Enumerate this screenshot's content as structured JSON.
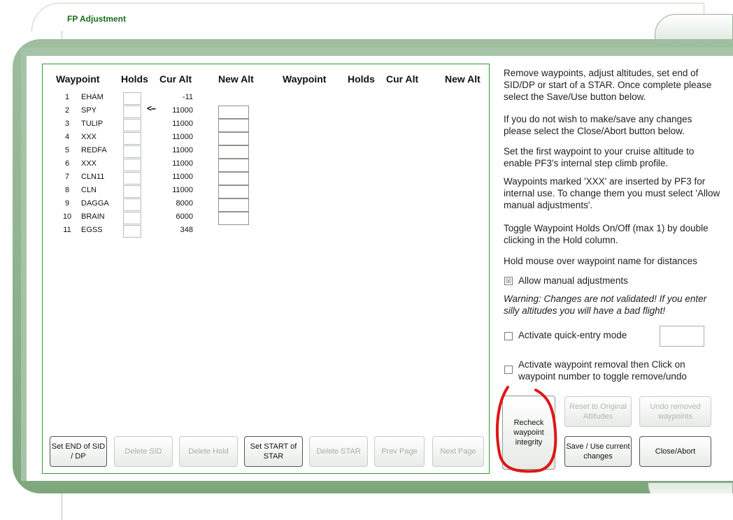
{
  "window": {
    "title": "FP Adjustment"
  },
  "table": {
    "headers": [
      "Waypoint",
      "Holds",
      "Cur Alt",
      "New Alt",
      "Waypoint",
      "Holds",
      "Cur Alt",
      "New Alt"
    ],
    "rows": [
      {
        "num": "1",
        "name": "EHAM",
        "cur": "-11"
      },
      {
        "num": "2",
        "name": "SPY",
        "cur": "11000"
      },
      {
        "num": "3",
        "name": "TULIP",
        "cur": "11000"
      },
      {
        "num": "4",
        "name": "XXX",
        "cur": "11000"
      },
      {
        "num": "5",
        "name": "REDFA",
        "cur": "11000"
      },
      {
        "num": "6",
        "name": "XXX",
        "cur": "11000"
      },
      {
        "num": "7",
        "name": "CLN11",
        "cur": "11000"
      },
      {
        "num": "8",
        "name": "CLN",
        "cur": "11000"
      },
      {
        "num": "9",
        "name": "DAGGA",
        "cur": "8000"
      },
      {
        "num": "10",
        "name": "BRAIN",
        "cur": "6000"
      },
      {
        "num": "11",
        "name": "EGSS",
        "cur": "348"
      }
    ],
    "current_arrow": "<--"
  },
  "buttons": {
    "set_end_sid": "Set END of SID / DP",
    "delete_sid": "Delete SID",
    "delete_hold": "Delete Hold",
    "set_start_star": "Set START of STAR",
    "delete_star": "Delete STAR",
    "prev_page": "Prev Page",
    "next_page": "Next Page"
  },
  "info": {
    "p1": "Remove waypoints, adjust altitudes, set end of SID/DP or start of a STAR. Once complete please select the Save/Use button below.",
    "p2": "If you do not wish to make/save any changes please select the Close/Abort button below.",
    "p3": "Set the first waypoint to your cruise altitude to enable PF3's internal step climb profile.",
    "p4": "Waypoints marked 'XXX' are inserted by PF3 for internal use. To change them you must select 'Allow manual adjustments'.",
    "p5": "Toggle Waypoint Holds On/Off (max 1) by double clicking in the Hold column.",
    "p6": "Hold mouse over waypoint name for distances",
    "allow_manual": "Allow manual adjustments",
    "warning": "Warning: Changes are not validated! If you enter silly altitudes you will have a bad flight!",
    "quick_entry": "Activate quick-entry mode",
    "removal": "Activate waypoint removal then Click on waypoint number to toggle remove/undo"
  },
  "right_buttons": {
    "recheck": "Recheck waypoint integrity",
    "reset": "Reset to Original Altitudes",
    "undo": "Undo removed waypoints",
    "save": "Save / Use current changes",
    "close": "Close/Abort"
  }
}
